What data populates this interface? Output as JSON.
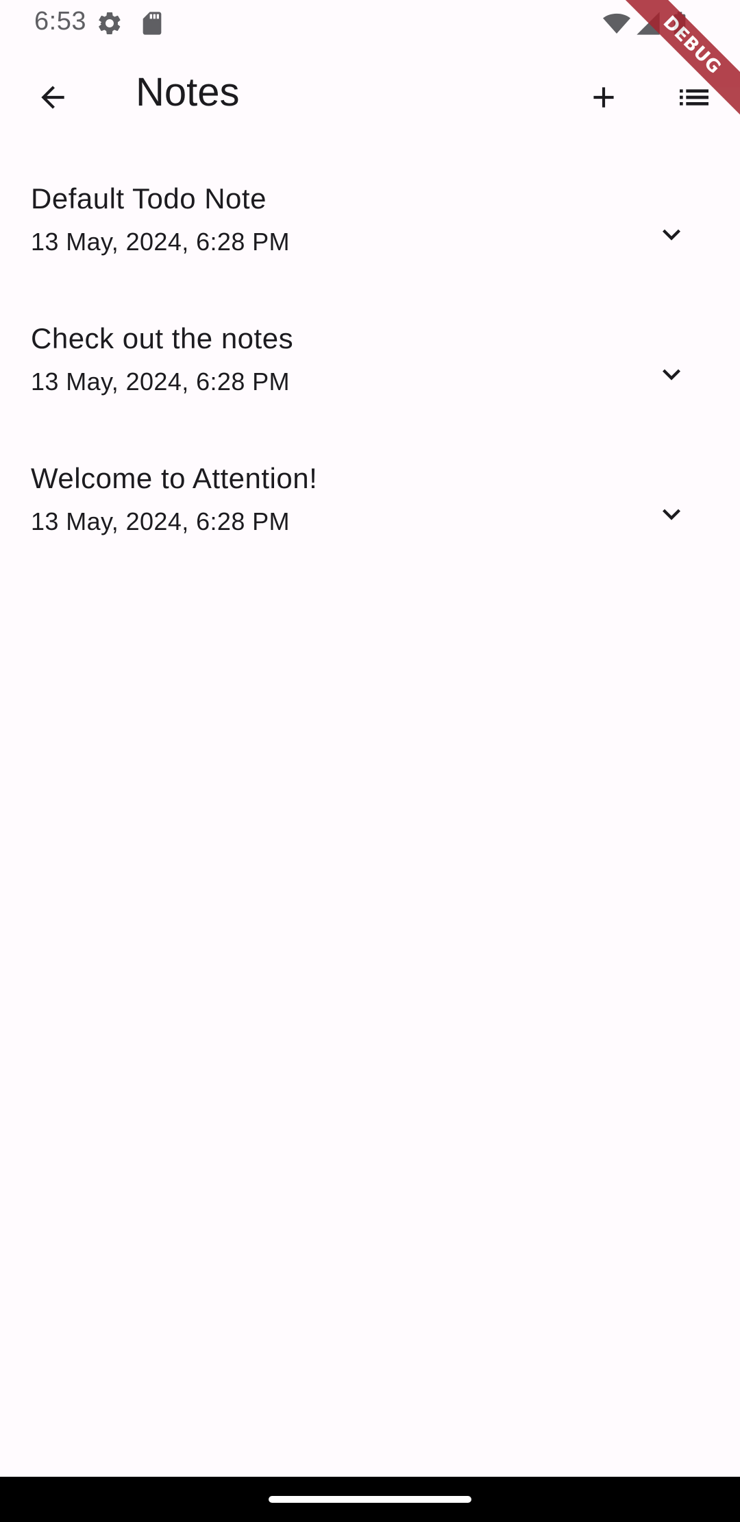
{
  "status_bar": {
    "time": "6:53",
    "icons": [
      "settings-gear-icon",
      "sd-card-icon",
      "wifi-icon",
      "cell-signal-icon",
      "battery-icon"
    ]
  },
  "debug_banner": {
    "label": "DEBUG",
    "color": "#a5242f"
  },
  "app_bar": {
    "title": "Notes",
    "leading_icon": "arrow-back-icon",
    "actions": [
      "add-icon",
      "list-view-icon"
    ]
  },
  "notes": [
    {
      "title": "Default Todo Note",
      "date": "13 May, 2024, 6:28 PM",
      "icon": "chevron-down-icon"
    },
    {
      "title": "Check out the notes",
      "date": "13 May, 2024, 6:28 PM",
      "icon": "chevron-down-icon"
    },
    {
      "title": "Welcome to Attention!",
      "date": "13 May, 2024, 6:28 PM",
      "icon": "chevron-down-icon"
    }
  ],
  "colors": {
    "background": "#fffbfe",
    "text": "#1c1b1f",
    "status_text": "#5f5f63",
    "nav_bar": "#000000"
  }
}
